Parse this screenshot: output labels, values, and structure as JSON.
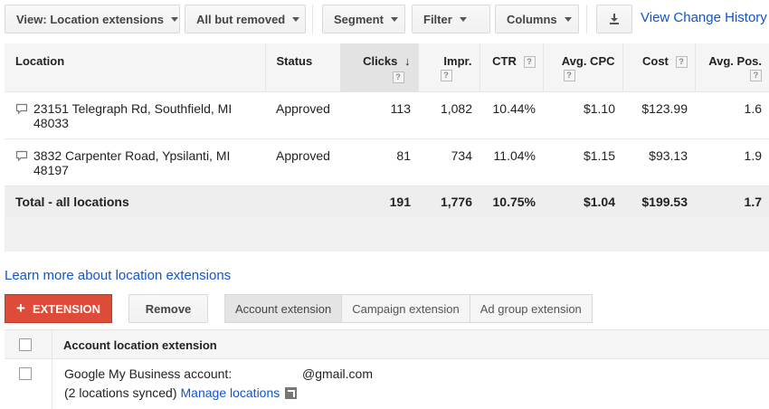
{
  "toolbar": {
    "view_label": "View: Location extensions",
    "filter_status_label": "All but removed",
    "segment_label": "Segment",
    "filter_label": "Filter",
    "columns_label": "Columns",
    "download_icon": "download-icon",
    "view_change_history": "View Change History"
  },
  "table": {
    "headers": {
      "location": "Location",
      "status": "Status",
      "clicks": "Clicks",
      "impr": "Impr.",
      "ctr": "CTR",
      "avg_cpc": "Avg. CPC",
      "cost": "Cost",
      "avg_pos": "Avg. Pos."
    },
    "help_glyph": "?",
    "sort_icon": "↓",
    "rows": [
      {
        "location_line1": "23151 Telegraph Rd, Southfield, MI",
        "location_line2": "48033",
        "status": "Approved",
        "clicks": "113",
        "impr": "1,082",
        "ctr": "10.44%",
        "avg_cpc": "$1.10",
        "cost": "$123.99",
        "avg_pos": "1.6"
      },
      {
        "location_line1": "3832 Carpenter Road, Ypsilanti, MI",
        "location_line2": "48197",
        "status": "Approved",
        "clicks": "81",
        "impr": "734",
        "ctr": "11.04%",
        "avg_cpc": "$1.15",
        "cost": "$93.13",
        "avg_pos": "1.9"
      }
    ],
    "total": {
      "label": "Total - all locations",
      "clicks": "191",
      "impr": "1,776",
      "ctr": "10.75%",
      "avg_cpc": "$1.04",
      "cost": "$199.53",
      "avg_pos": "1.7"
    }
  },
  "learn_more": "Learn more about location extensions",
  "actions": {
    "add_extension": "EXTENSION",
    "add_icon": "+",
    "remove": "Remove"
  },
  "tabs": [
    {
      "label": "Account extension",
      "active": true
    },
    {
      "label": "Campaign extension",
      "active": false
    },
    {
      "label": "Ad group extension",
      "active": false
    }
  ],
  "account": {
    "header": "Account location extension",
    "row_line1": "Google My Business account:",
    "email": "@gmail.com",
    "row_line2": "(2 locations synced)",
    "manage_link": "Manage locations"
  },
  "colors": {
    "accent_red": "#dd4b39",
    "link_blue": "#1155cc"
  }
}
